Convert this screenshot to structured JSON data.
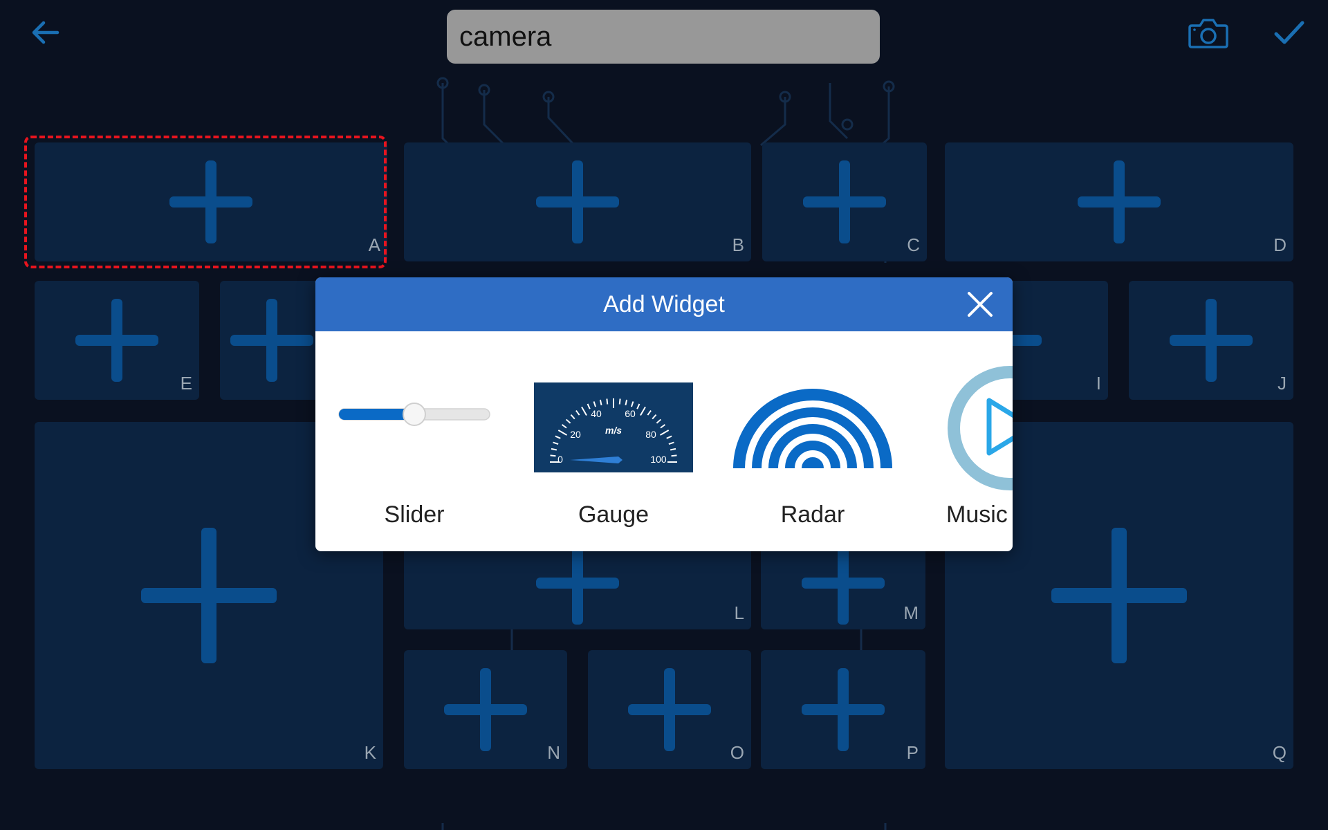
{
  "header": {
    "back_icon": "arrow-left-icon",
    "title_value": "camera",
    "camera_icon": "camera-icon",
    "confirm_icon": "checkmark-icon"
  },
  "colors": {
    "background": "#0a1120",
    "cell": "#0c2340",
    "plus": "#0a4d8c",
    "icon": "#1a6fb3",
    "selection": "#e8141e",
    "dialog_header": "#2f6dc4",
    "widget_blue": "#0a6ac6"
  },
  "grid": {
    "cells": [
      {
        "label": "A",
        "selected": true
      },
      {
        "label": "B"
      },
      {
        "label": "C"
      },
      {
        "label": "D"
      },
      {
        "label": "E"
      },
      {
        "label": "I"
      },
      {
        "label": "J"
      },
      {
        "label": "K"
      },
      {
        "label": "L"
      },
      {
        "label": "M"
      },
      {
        "label": "N"
      },
      {
        "label": "O"
      },
      {
        "label": "P"
      },
      {
        "label": "Q"
      }
    ]
  },
  "dialog": {
    "title": "Add Widget",
    "close_icon": "close-icon",
    "widgets": [
      {
        "label": "Slider",
        "icon": "slider-icon",
        "slider_value": 0.5
      },
      {
        "label": "Gauge",
        "icon": "gauge-icon",
        "gauge_ticks": [
          "0",
          "20",
          "40",
          "60",
          "80",
          "100"
        ],
        "gauge_unit": "m/s"
      },
      {
        "label": "Radar",
        "icon": "radar-icon"
      },
      {
        "label": "Music",
        "icon": "music-play-icon"
      }
    ]
  }
}
